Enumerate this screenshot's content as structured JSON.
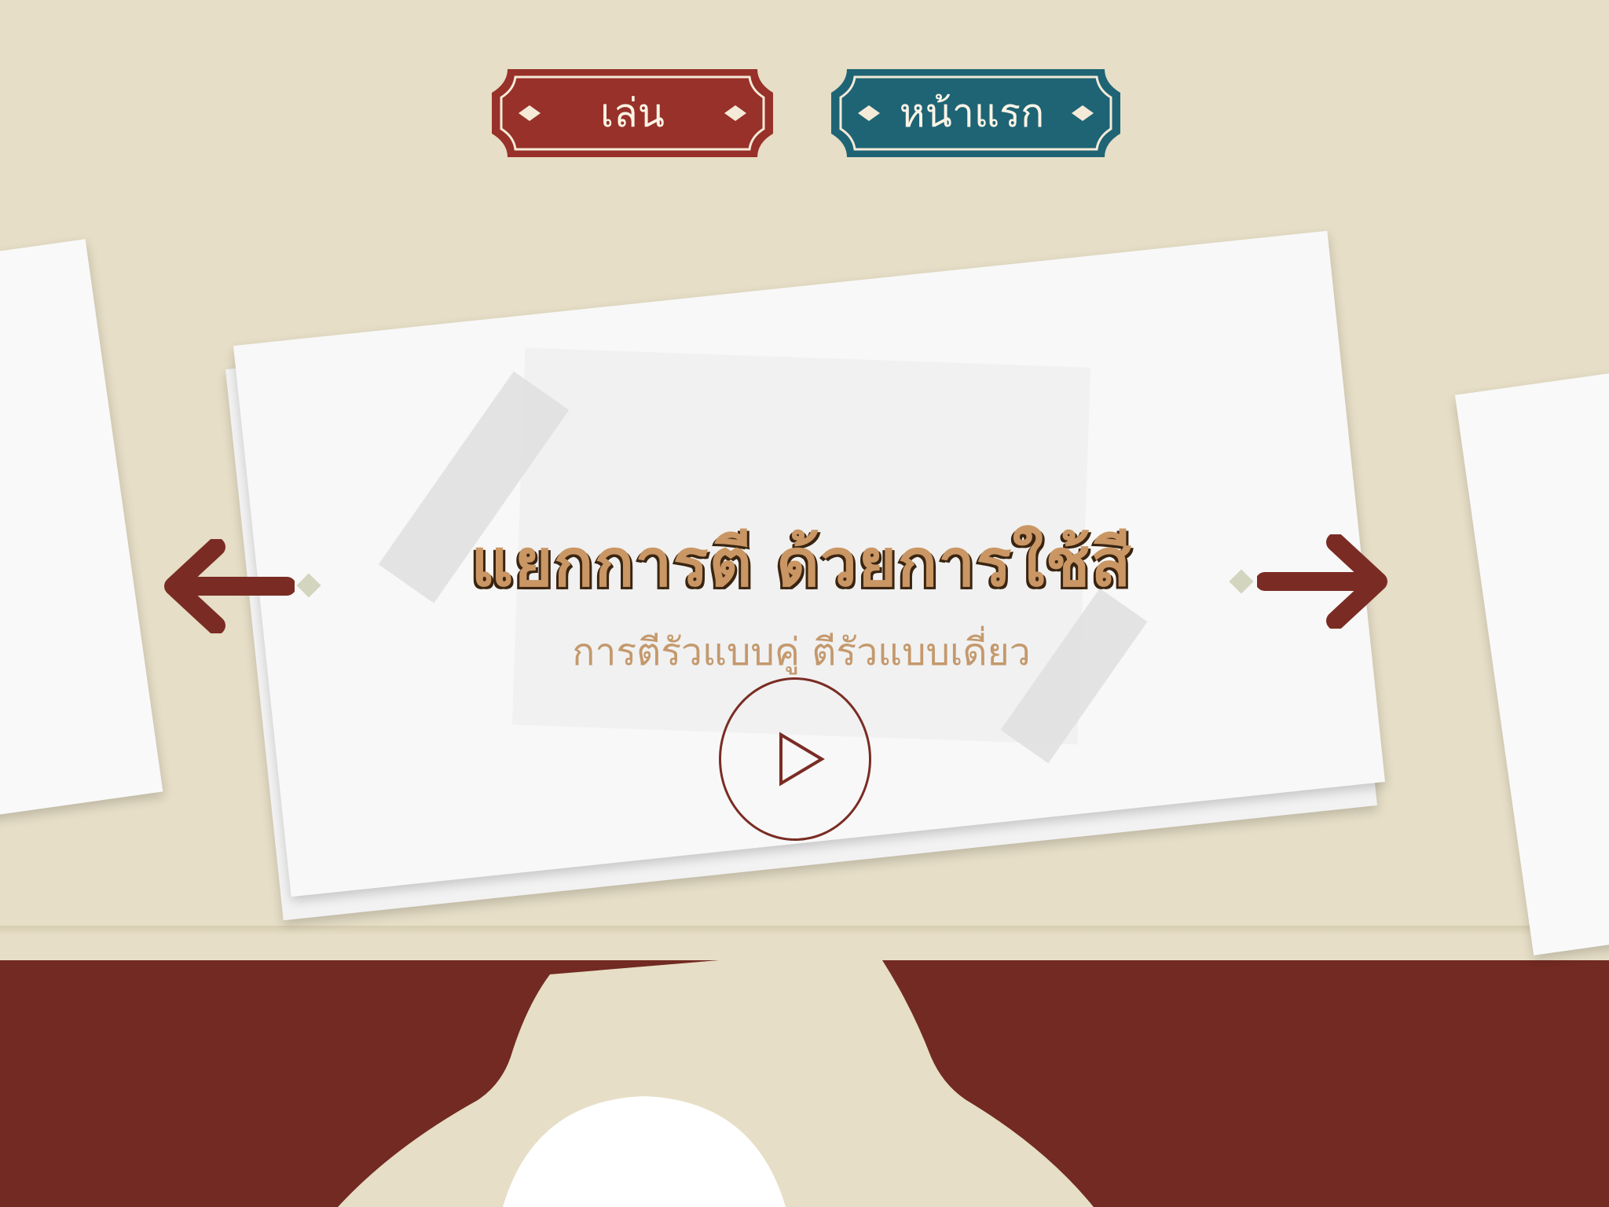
{
  "toolbar": {
    "play_label": "เล่น",
    "home_label": "หน้าแรก"
  },
  "card": {
    "title": "แยกการตี ด้วยการใช้สี",
    "subtitle": "การตีรัวแบบคู่ ตีรัวแบบเดี่ยว"
  },
  "icons": {
    "prev": "arrow-left-icon",
    "next": "arrow-right-icon",
    "play": "play-triangle-icon"
  },
  "colors": {
    "background": "#e6dec6",
    "band": "#722a22",
    "play_button": "#973129",
    "home_button": "#1e6475",
    "arrow": "#7a2c24",
    "title": "#c99664"
  }
}
